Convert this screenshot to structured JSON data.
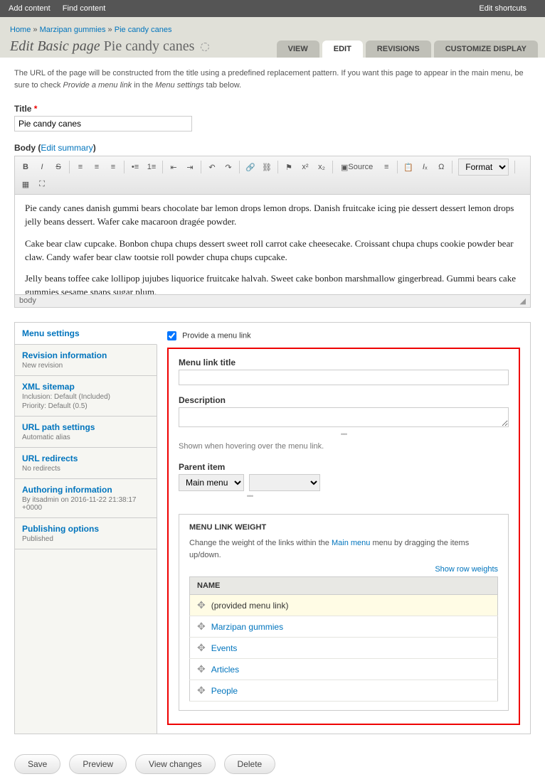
{
  "toolbar": {
    "add": "Add content",
    "find": "Find content",
    "edit_shortcuts": "Edit shortcuts"
  },
  "breadcrumb": {
    "home": "Home",
    "parent": "Marzipan gummies",
    "current": "Pie candy canes"
  },
  "page_title": {
    "prefix": "Edit Basic page",
    "name": "Pie candy canes"
  },
  "tabs": {
    "view": "VIEW",
    "edit": "EDIT",
    "revisions": "REVISIONS",
    "customize": "CUSTOMIZE DISPLAY"
  },
  "helptext": {
    "a": "The URL of the page will be constructed from the title using a predefined replacement pattern. If you want this page to appear in the main menu, be sure to check ",
    "em1": "Provide a menu link",
    "b": " in the ",
    "em2": "Menu settings",
    "c": " tab below."
  },
  "fields": {
    "title_label": "Title",
    "title_value": "Pie candy canes",
    "body_label": "Body",
    "edit_summary": "Edit summary"
  },
  "editor": {
    "source": "Source",
    "format": "Format",
    "path": "body",
    "p1": "Pie candy canes danish gummi bears chocolate bar lemon drops lemon drops. Danish fruitcake icing pie dessert dessert lemon drops jelly beans dessert. Wafer cake macaroon dragée powder.",
    "p2": "Cake bear claw cupcake. Bonbon chupa chups dessert sweet roll carrot cake cheesecake. Croissant chupa chups cookie powder bear claw. Candy wafer bear claw tootsie roll powder chupa chups cupcake.",
    "p3": "Jelly beans toffee cake lollipop jujubes liquorice fruitcake halvah. Sweet cake bonbon marshmallow gingerbread. Gummi bears cake gummies sesame snaps sugar plum."
  },
  "vtabs": {
    "menu": {
      "t": "Menu settings"
    },
    "rev": {
      "t": "Revision information",
      "s": "New revision"
    },
    "xml": {
      "t": "XML sitemap",
      "s1": "Inclusion: Default (Included)",
      "s2": "Priority: Default (0.5)"
    },
    "url": {
      "t": "URL path settings",
      "s": "Automatic alias"
    },
    "redir": {
      "t": "URL redirects",
      "s": "No redirects"
    },
    "auth": {
      "t": "Authoring information",
      "s": "By itsadmin on 2016-11-22 21:38:17 +0000"
    },
    "pub": {
      "t": "Publishing options",
      "s": "Published"
    }
  },
  "menu_pane": {
    "provide": "Provide a menu link",
    "link_title": "Menu link title",
    "description": "Description",
    "desc_help": "Shown when hovering over the menu link.",
    "parent": "Parent item",
    "parent_value": "Main menu",
    "weight_title": "MENU LINK WEIGHT",
    "weight_desc_a": "Change the weight of the links within the ",
    "weight_desc_link": "Main menu",
    "weight_desc_b": " menu by dragging the items up/down.",
    "show_weights": "Show row weights",
    "col_name": "NAME",
    "rows": [
      {
        "label": "(provided menu link)",
        "link": false
      },
      {
        "label": "Marzipan gummies",
        "link": true
      },
      {
        "label": "Events",
        "link": true
      },
      {
        "label": "Articles",
        "link": true
      },
      {
        "label": "People",
        "link": true
      }
    ]
  },
  "actions": {
    "save": "Save",
    "preview": "Preview",
    "view_changes": "View changes",
    "delete": "Delete"
  }
}
